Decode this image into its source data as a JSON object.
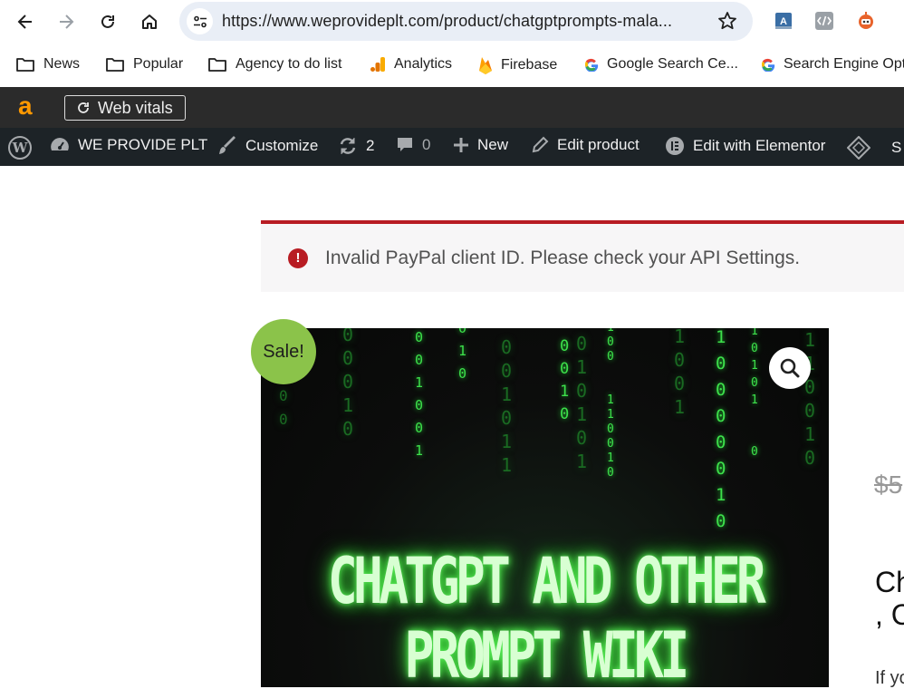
{
  "browser": {
    "url": "https://www.weprovideplt.com/product/chatgptprompts-mala...",
    "icons": [
      "back-arrow-icon",
      "forward-arrow-icon",
      "reload-icon",
      "home-icon",
      "site-info-icon",
      "bookmark-star-icon"
    ],
    "extensions": [
      "translate-extension-icon",
      "code-extension-icon",
      "robot-extension-icon"
    ]
  },
  "bookmarks": [
    {
      "label": "News",
      "icon": "folder-icon"
    },
    {
      "label": "Popular",
      "icon": "folder-icon"
    },
    {
      "label": "Agency to do list",
      "icon": "folder-icon"
    },
    {
      "label": "Analytics",
      "icon": "analytics-icon"
    },
    {
      "label": "Firebase",
      "icon": "firebase-icon"
    },
    {
      "label": "Google Search Ce...",
      "icon": "google-icon"
    },
    {
      "label": "Search Engine Opt",
      "icon": "google-icon"
    }
  ],
  "toolbar": {
    "amazon_logo": "a",
    "web_vitals_label": "Web vitals"
  },
  "wp_admin_bar": {
    "site_name": "WE PROVIDE PLT",
    "customize": "Customize",
    "updates_count": "2",
    "comments_count": "0",
    "new": "New",
    "edit_product": "Edit product",
    "edit_elementor": "Edit with Elementor",
    "trailing": "S"
  },
  "notice": {
    "message": "Invalid PayPal client ID. Please check your API Settings.",
    "icon_glyph": "!"
  },
  "product": {
    "sale_badge": "Sale!",
    "image_title_line1": "CHATGPT AND OTHER",
    "image_title_line2": "PROMPT WIKI",
    "old_price": "$5",
    "title_line1": "Ch",
    "title_line2": ", C",
    "description": "If yo"
  },
  "colors": {
    "notice_red": "#b81c23",
    "sale_green": "#8bc34a",
    "wp_bar": "#1d2327",
    "amazon_orange": "#ff9900",
    "matrix_green": "#3de04b"
  }
}
